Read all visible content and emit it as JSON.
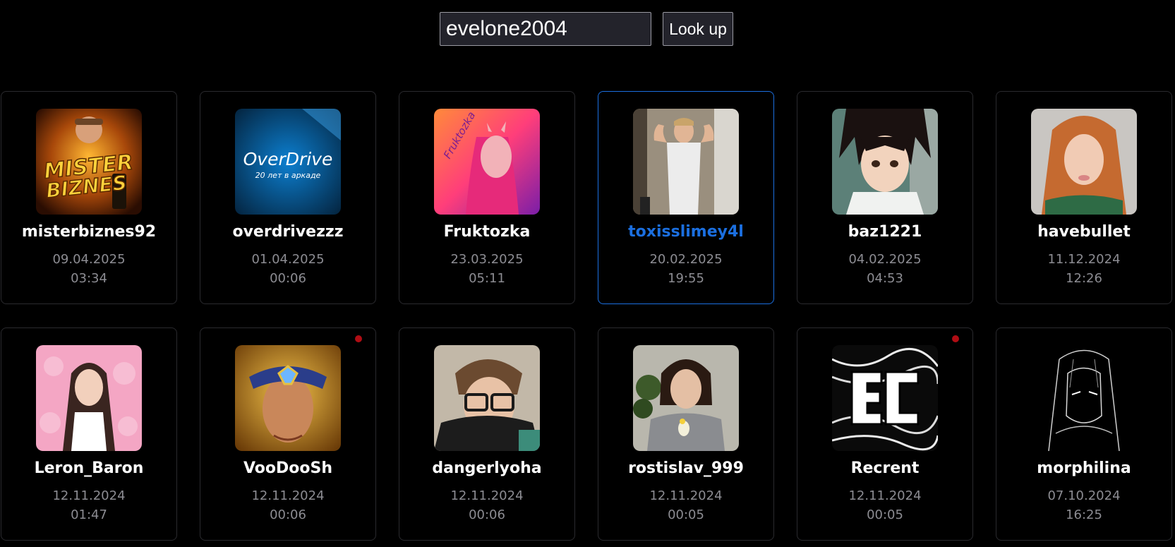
{
  "search": {
    "value": "evelone2004",
    "button_label": "Look up"
  },
  "accent_color": "#1b6fe0",
  "live_color": "#b00d14",
  "cards": [
    {
      "name": "misterbiznes92",
      "date": "09.04.2025",
      "time": "03:34",
      "avatar_text": [
        "MISTER",
        "BIZNES"
      ]
    },
    {
      "name": "overdrivezzz",
      "date": "01.04.2025",
      "time": "00:06",
      "avatar_text": [
        "OverDrive",
        "20 лет в аркаде"
      ]
    },
    {
      "name": "Fruktozka",
      "date": "23.03.2025",
      "time": "05:11",
      "avatar_text": [
        "Fruktozka"
      ]
    },
    {
      "name": "toxisslimey4l",
      "date": "20.02.2025",
      "time": "19:55",
      "selected": true
    },
    {
      "name": "baz1221",
      "date": "04.02.2025",
      "time": "04:53"
    },
    {
      "name": "havebullet",
      "date": "11.12.2024",
      "time": "12:26"
    },
    {
      "name": "Leron_Baron",
      "date": "12.11.2024",
      "time": "01:47"
    },
    {
      "name": "VooDooSh",
      "date": "12.11.2024",
      "time": "00:06",
      "live": true
    },
    {
      "name": "dangerlyoha",
      "date": "12.11.2024",
      "time": "00:06"
    },
    {
      "name": "rostislav_999",
      "date": "12.11.2024",
      "time": "00:05"
    },
    {
      "name": "Recrent",
      "date": "12.11.2024",
      "time": "00:05",
      "live": true
    },
    {
      "name": "morphilina",
      "date": "07.10.2024",
      "time": "16:25"
    }
  ]
}
